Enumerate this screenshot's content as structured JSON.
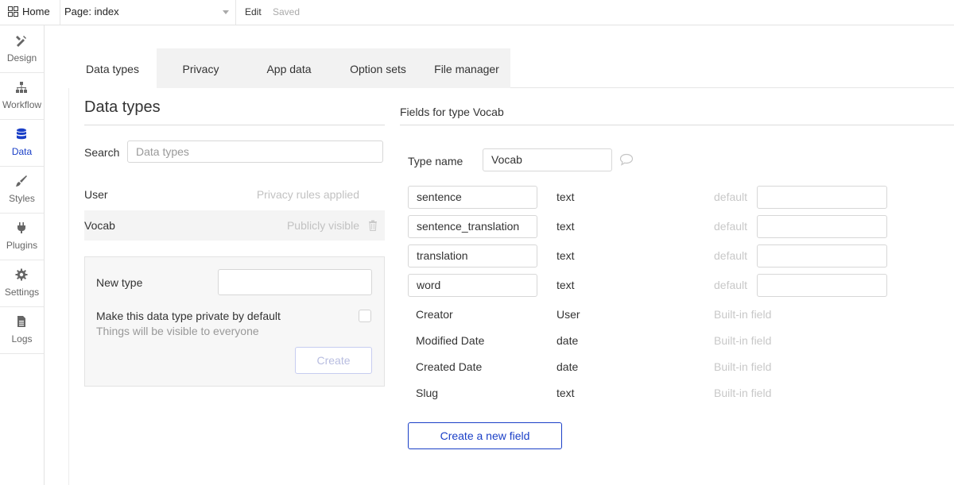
{
  "topbar": {
    "home_label": "Home",
    "page_label": "Page: index",
    "edit_label": "Edit",
    "saved_label": "Saved"
  },
  "sidebar": {
    "items": [
      {
        "label": "Design",
        "icon": "design-icon"
      },
      {
        "label": "Workflow",
        "icon": "workflow-icon"
      },
      {
        "label": "Data",
        "icon": "database-icon",
        "active": true
      },
      {
        "label": "Styles",
        "icon": "brush-icon"
      },
      {
        "label": "Plugins",
        "icon": "plug-icon"
      },
      {
        "label": "Settings",
        "icon": "gear-icon"
      },
      {
        "label": "Logs",
        "icon": "document-icon"
      }
    ],
    "active_color": "#1a3fc7"
  },
  "tabs": [
    {
      "label": "Data types",
      "active": true
    },
    {
      "label": "Privacy"
    },
    {
      "label": "App data"
    },
    {
      "label": "Option sets"
    },
    {
      "label": "File manager"
    }
  ],
  "left": {
    "heading": "Data types",
    "search_label": "Search",
    "search_placeholder": "Data types",
    "types": [
      {
        "name": "User",
        "status": "Privacy rules applied"
      },
      {
        "name": "Vocab",
        "status": "Publicly visible",
        "selected": true
      }
    ],
    "new_type": {
      "label": "New type",
      "value": "",
      "private_label": "Make this data type private by default",
      "private_sub": "Things will be visible to everyone",
      "create_label": "Create"
    }
  },
  "right": {
    "title": "Fields for type Vocab",
    "type_name_label": "Type name",
    "type_name_value": "Vocab",
    "fields": [
      {
        "name": "sentence",
        "type": "text",
        "default_label": "default",
        "default_value": ""
      },
      {
        "name": "sentence_translation",
        "type": "text",
        "default_label": "default",
        "default_value": ""
      },
      {
        "name": "translation",
        "type": "text",
        "default_label": "default",
        "default_value": ""
      },
      {
        "name": "word",
        "type": "text",
        "default_label": "default",
        "default_value": ""
      }
    ],
    "builtin": [
      {
        "name": "Creator",
        "type": "User",
        "note": "Built-in field"
      },
      {
        "name": "Modified Date",
        "type": "date",
        "note": "Built-in field"
      },
      {
        "name": "Created Date",
        "type": "date",
        "note": "Built-in field"
      },
      {
        "name": "Slug",
        "type": "text",
        "note": "Built-in field"
      }
    ],
    "new_field_label": "Create a new field"
  },
  "colors": {
    "accent": "#1a3fc7",
    "muted_text": "#c8c8c8"
  }
}
